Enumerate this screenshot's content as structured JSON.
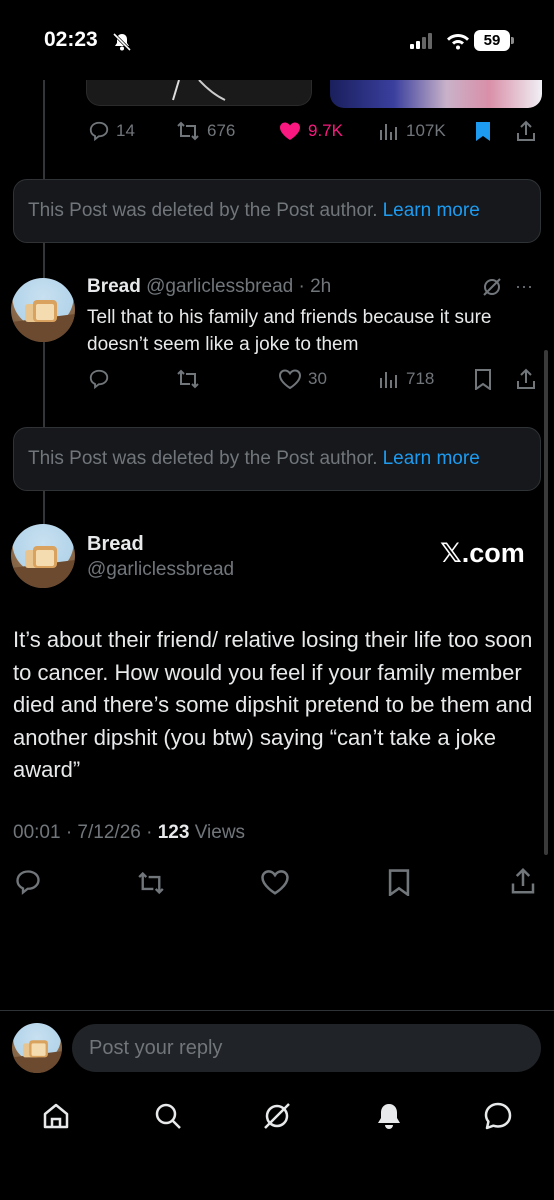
{
  "status_bar": {
    "time": "02:23",
    "battery": "59",
    "icons": [
      "bell-slash-icon",
      "signal-icon",
      "wifi-icon",
      "battery-icon"
    ]
  },
  "top_post": {
    "actions": {
      "replies": "14",
      "reposts": "676",
      "likes": "9.7K",
      "views": "107K"
    },
    "liked": true,
    "bookmarked": true
  },
  "deleted_notice": {
    "text": "This Post was deleted by the Post author.",
    "link": "Learn more"
  },
  "reply_post": {
    "name": "Bread",
    "handle_time": "@garliclessbread · 2h",
    "text": "Tell that to his family and friends because it sure doesn’t seem like a joke to them",
    "actions": {
      "likes": "30",
      "views": "718"
    },
    "more": "···"
  },
  "main_post": {
    "name": "Bread",
    "handle": "@garliclessbread",
    "watermark": "𝕏.com",
    "text": "It’s about their friend/ relative losing their life too soon to cancer. How would you feel if your family member died and there’s some dipshit pretend to be them and another dipshit (you btw) saying “can’t take a joke award”",
    "meta_prefix": "00:01 · 7/12/26 · ",
    "views_count": "123",
    "views_label": " Views"
  },
  "composer": {
    "placeholder": "Post your reply"
  },
  "colors": {
    "accent": "#1d9bf0",
    "like": "#f91880",
    "muted": "#71767b",
    "background": "#000000",
    "card": "#16181c"
  },
  "bottom_nav": [
    "home-icon",
    "search-icon",
    "grok-icon",
    "notifications-icon",
    "messages-icon"
  ]
}
